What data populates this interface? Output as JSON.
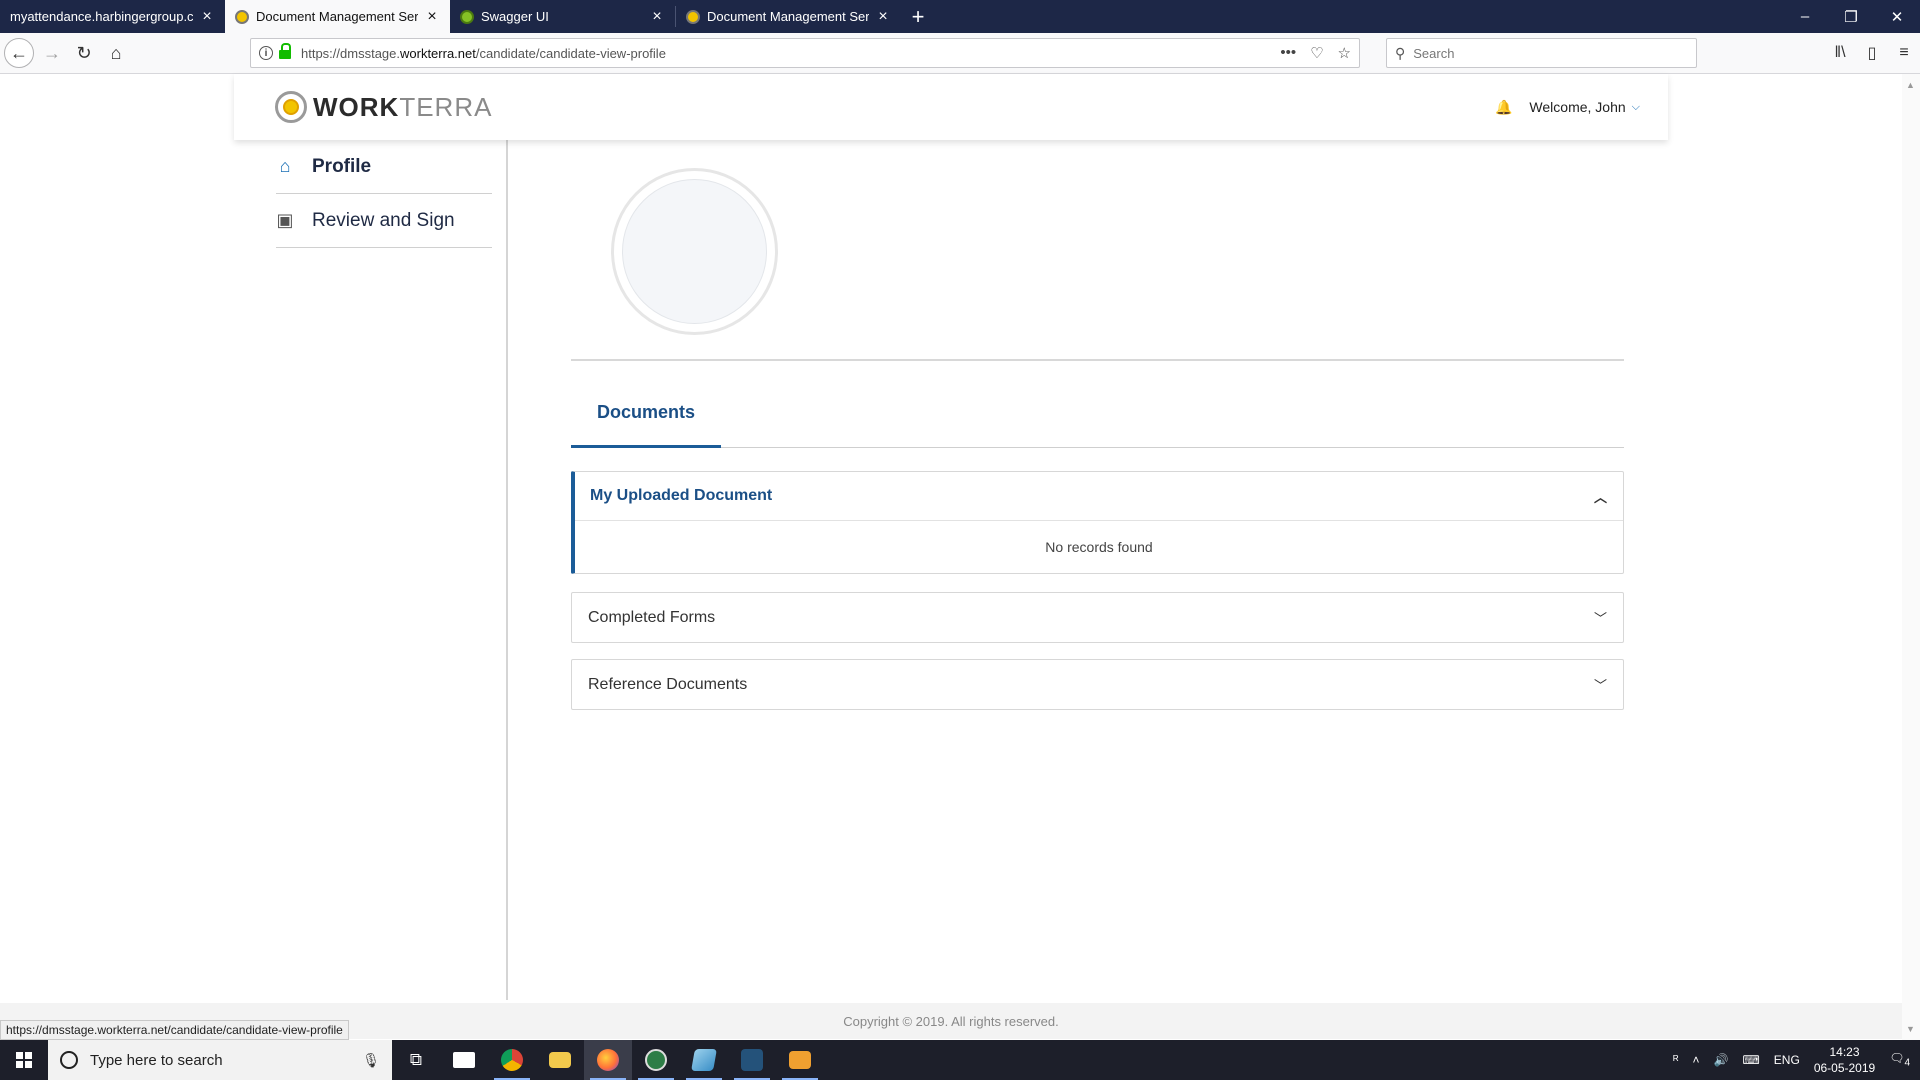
{
  "browser": {
    "tabs": [
      {
        "label": "myattendance.harbingergroup.com",
        "favicon": "none",
        "active": false
      },
      {
        "label": "Document Management Service",
        "favicon": "workterra-logo-icon",
        "active": true
      },
      {
        "label": "Swagger UI",
        "favicon": "swagger-icon",
        "active": false
      },
      {
        "label": "Document Management Service",
        "favicon": "workterra-logo-icon",
        "active": false
      }
    ],
    "new_tab": "+",
    "url_prefix": "https://dmsstage.",
    "url_host": "workterra.net",
    "url_path": "/candidate/candidate-view-profile",
    "search_placeholder": "Search",
    "status_url": "https://dmsstage.workterra.net/candidate/candidate-view-profile"
  },
  "app": {
    "logo_bold": "WORK",
    "logo_light": "TERRA",
    "welcome": "Welcome, John",
    "sidebar": [
      {
        "label": "Profile",
        "icon": "home-icon",
        "active": true
      },
      {
        "label": "Review and Sign",
        "icon": "clipboard-icon",
        "active": false
      }
    ],
    "documents_tab": "Documents",
    "panels": [
      {
        "title": "My Uploaded Document",
        "expanded": true,
        "body": "No records found"
      },
      {
        "title": "Completed Forms",
        "expanded": false
      },
      {
        "title": "Reference Documents",
        "expanded": false
      }
    ],
    "copyright": "Copyright © 2019. All rights reserved."
  },
  "taskbar": {
    "search_placeholder": "Type here to search",
    "language": "ENG",
    "time": "14:23",
    "date": "06-05-2019",
    "notification_count": "4"
  },
  "colors": {
    "accent": "#1b5c98",
    "tab_strip": "#1d2747",
    "taskbar": "#1d1f2a"
  }
}
